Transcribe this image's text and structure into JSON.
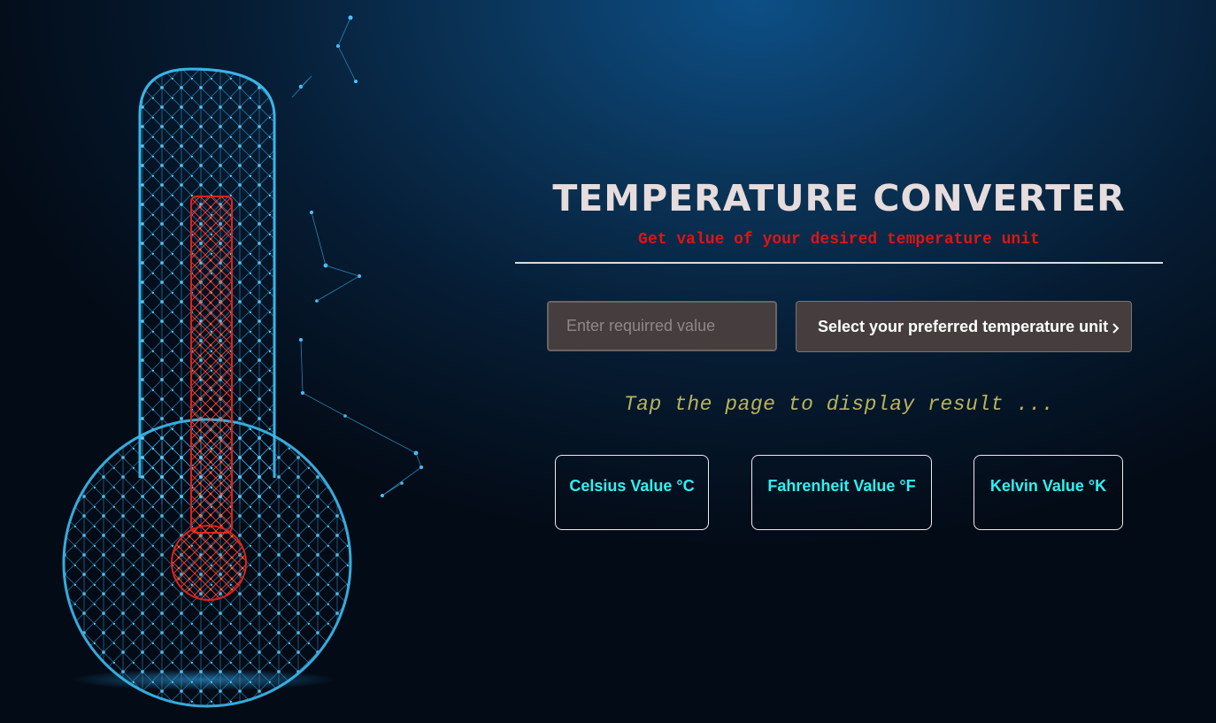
{
  "header": {
    "title": "TEMPERATURE CONVERTER",
    "subtitle": "Get value of your desired temperature unit"
  },
  "form": {
    "value_placeholder": "Enter requirred value",
    "value": "",
    "unit_selected": "Select your preferred temperature unit"
  },
  "prompt": "Tap the page to display result ...",
  "results": {
    "celsius_label": "Celsius Value °C",
    "fahrenheit_label": "Fahrenheit Value °F",
    "kelvin_label": "Kelvin Value °K"
  },
  "icons": {
    "hero": "thermometer-icon",
    "select_arrow": "chevron-down-icon"
  },
  "colors": {
    "title": "#e6dcdc",
    "subtitle": "#e01414",
    "prompt": "#b9b45c",
    "result_text": "#2ef2f2",
    "field_bg": "#463e3e",
    "thermometer_glow": "#2aa8e8",
    "mercury": "#e0211c"
  }
}
